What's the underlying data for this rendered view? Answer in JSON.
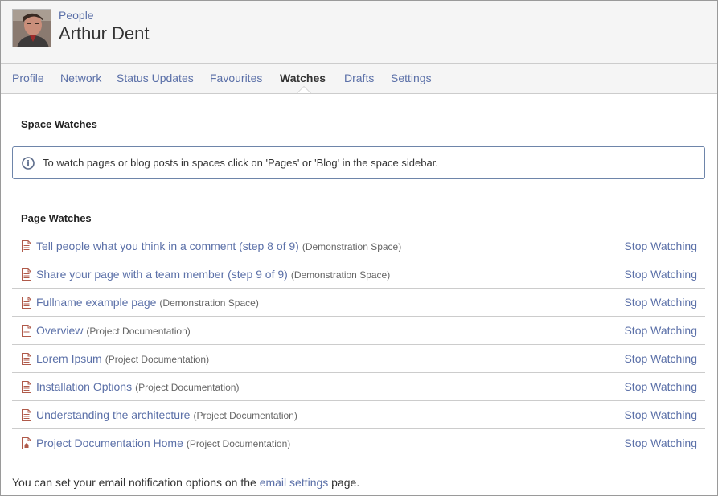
{
  "header": {
    "breadcrumb": "People",
    "title": "Arthur Dent"
  },
  "tabs": [
    {
      "label": "Profile",
      "active": false
    },
    {
      "label": "Network",
      "active": false
    },
    {
      "label": "Status Updates",
      "active": false
    },
    {
      "label": "Favourites",
      "active": false
    },
    {
      "label": "Watches",
      "active": true
    },
    {
      "label": "Drafts",
      "active": false
    },
    {
      "label": "Settings",
      "active": false
    }
  ],
  "space_watches": {
    "heading": "Space Watches",
    "info": "To watch pages or blog posts in spaces click on 'Pages' or 'Blog' in the space sidebar."
  },
  "page_watches": {
    "heading": "Page Watches",
    "stop_label": "Stop Watching",
    "items": [
      {
        "title": "Tell people what you think in a comment (step 8 of 9)",
        "space": "(Demonstration Space)",
        "icon": "page-icon"
      },
      {
        "title": "Share your page with a team member (step 9 of 9)",
        "space": "(Demonstration Space)",
        "icon": "page-icon"
      },
      {
        "title": "Fullname example page",
        "space": "(Demonstration Space)",
        "icon": "page-icon"
      },
      {
        "title": "Overview",
        "space": "(Project Documentation)",
        "icon": "page-icon"
      },
      {
        "title": "Lorem Ipsum",
        "space": "(Project Documentation)",
        "icon": "page-icon"
      },
      {
        "title": "Installation Options",
        "space": "(Project Documentation)",
        "icon": "page-icon"
      },
      {
        "title": "Understanding the architecture",
        "space": "(Project Documentation)",
        "icon": "page-icon"
      },
      {
        "title": "Project Documentation Home",
        "space": "(Project Documentation)",
        "icon": "home-page-icon"
      }
    ]
  },
  "footer": {
    "prefix": "You can set your email notification options on the",
    "link": "email settings",
    "suffix": "page."
  },
  "colors": {
    "link": "#5b70a8",
    "info_border": "#6e85aa",
    "header_bg": "#f5f5f5",
    "page_icon": "#b05a4a"
  }
}
